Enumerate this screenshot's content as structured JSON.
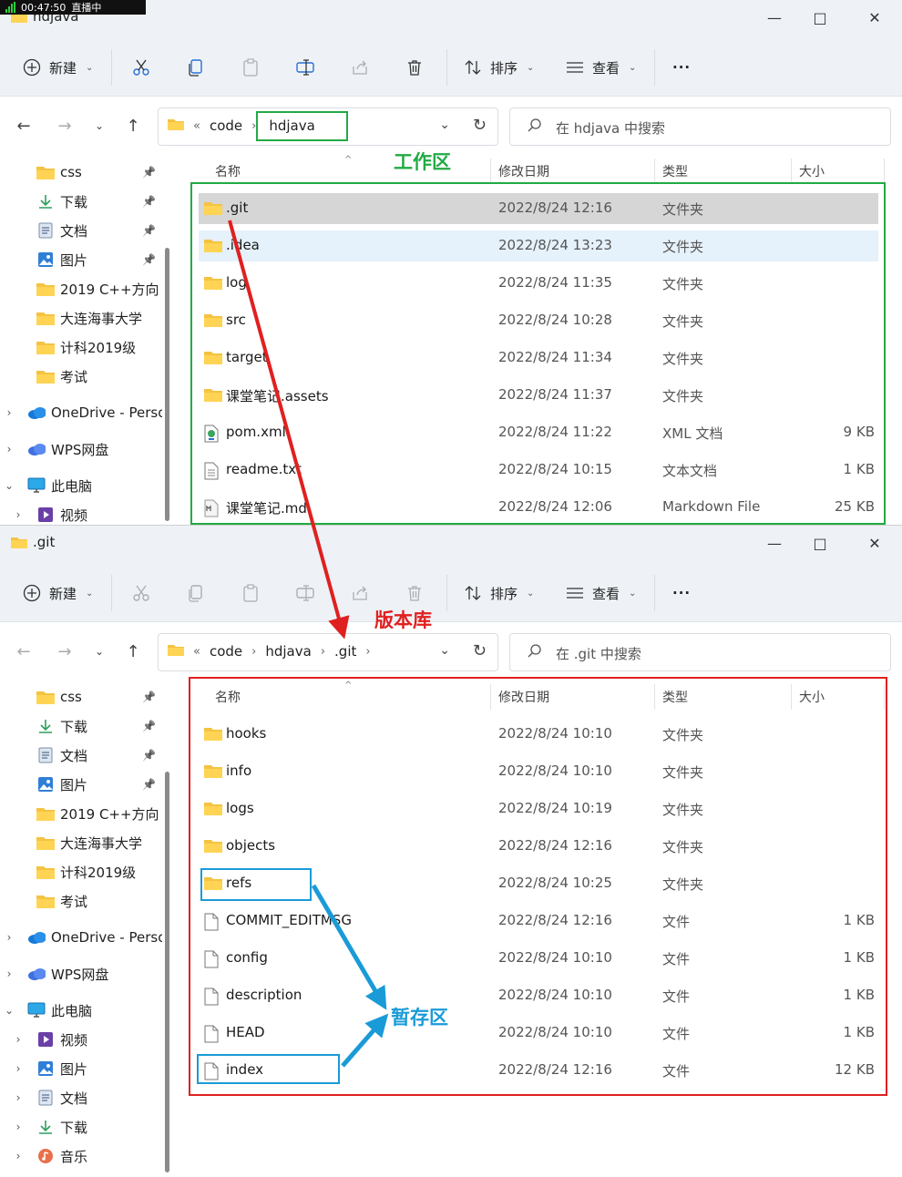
{
  "status_overlay": {
    "time": "00:47:50",
    "status": "直播中"
  },
  "window1": {
    "title": "hdjava",
    "toolbar": {
      "new": "新建",
      "sort": "排序",
      "view": "查看",
      "more": "···"
    },
    "breadcrumb": [
      "code",
      "hdjava"
    ],
    "breadcrumb_overflow": "«",
    "search_placeholder": "在 hdjava 中搜索",
    "columns": {
      "name": "名称",
      "date": "修改日期",
      "type": "类型",
      "size": "大小"
    },
    "files": [
      {
        "name": ".git",
        "date": "2022/8/24 12:16",
        "type": "文件夹",
        "size": "",
        "icon": "folder",
        "state": "selected"
      },
      {
        "name": ".idea",
        "date": "2022/8/24 13:23",
        "type": "文件夹",
        "size": "",
        "icon": "folder",
        "state": "hover"
      },
      {
        "name": "log",
        "date": "2022/8/24 11:35",
        "type": "文件夹",
        "size": "",
        "icon": "folder"
      },
      {
        "name": "src",
        "date": "2022/8/24 10:28",
        "type": "文件夹",
        "size": "",
        "icon": "folder"
      },
      {
        "name": "target",
        "date": "2022/8/24 11:34",
        "type": "文件夹",
        "size": "",
        "icon": "folder"
      },
      {
        "name": "课堂笔记.assets",
        "date": "2022/8/24 11:37",
        "type": "文件夹",
        "size": "",
        "icon": "folder"
      },
      {
        "name": "pom.xml",
        "date": "2022/8/24 11:22",
        "type": "XML 文档",
        "size": "9 KB",
        "icon": "xml"
      },
      {
        "name": "readme.txt",
        "date": "2022/8/24 10:15",
        "type": "文本文档",
        "size": "1 KB",
        "icon": "txt"
      },
      {
        "name": "课堂笔记.md",
        "date": "2022/8/24 12:06",
        "type": "Markdown File",
        "size": "25 KB",
        "icon": "md"
      }
    ],
    "sidebar": [
      {
        "label": "css",
        "icon": "folder",
        "pinned": true
      },
      {
        "label": "下载",
        "icon": "download",
        "pinned": true
      },
      {
        "label": "文档",
        "icon": "document",
        "pinned": true
      },
      {
        "label": "图片",
        "icon": "picture",
        "pinned": true
      },
      {
        "label": "2019 C++方向",
        "icon": "folder",
        "pinned": false
      },
      {
        "label": "大连海事大学",
        "icon": "folder",
        "pinned": false
      },
      {
        "label": "计科2019级",
        "icon": "folder",
        "pinned": false
      },
      {
        "label": "考试",
        "icon": "folder",
        "pinned": false
      },
      {
        "label": "OneDrive - Perso",
        "icon": "onedrive",
        "chevron": "›"
      },
      {
        "label": "WPS网盘",
        "icon": "wps",
        "chevron": "›"
      },
      {
        "label": "此电脑",
        "icon": "pc",
        "chevron": "⌄"
      },
      {
        "label": "视频",
        "icon": "video",
        "chevron": "›"
      }
    ]
  },
  "window2": {
    "title": ".git",
    "toolbar": {
      "new": "新建",
      "sort": "排序",
      "view": "查看",
      "more": "···"
    },
    "breadcrumb": [
      "code",
      "hdjava",
      ".git"
    ],
    "breadcrumb_overflow": "«",
    "search_placeholder": "在 .git 中搜索",
    "columns": {
      "name": "名称",
      "date": "修改日期",
      "type": "类型",
      "size": "大小"
    },
    "files": [
      {
        "name": "hooks",
        "date": "2022/8/24 10:10",
        "type": "文件夹",
        "size": "",
        "icon": "folder"
      },
      {
        "name": "info",
        "date": "2022/8/24 10:10",
        "type": "文件夹",
        "size": "",
        "icon": "folder"
      },
      {
        "name": "logs",
        "date": "2022/8/24 10:19",
        "type": "文件夹",
        "size": "",
        "icon": "folder"
      },
      {
        "name": "objects",
        "date": "2022/8/24 12:16",
        "type": "文件夹",
        "size": "",
        "icon": "folder"
      },
      {
        "name": "refs",
        "date": "2022/8/24 10:25",
        "type": "文件夹",
        "size": "",
        "icon": "folder"
      },
      {
        "name": "COMMIT_EDITMSG",
        "date": "2022/8/24 12:16",
        "type": "文件",
        "size": "1 KB",
        "icon": "file"
      },
      {
        "name": "config",
        "date": "2022/8/24 10:10",
        "type": "文件",
        "size": "1 KB",
        "icon": "file"
      },
      {
        "name": "description",
        "date": "2022/8/24 10:10",
        "type": "文件",
        "size": "1 KB",
        "icon": "file"
      },
      {
        "name": "HEAD",
        "date": "2022/8/24 10:10",
        "type": "文件",
        "size": "1 KB",
        "icon": "file"
      },
      {
        "name": "index",
        "date": "2022/8/24 12:16",
        "type": "文件",
        "size": "12 KB",
        "icon": "file"
      }
    ],
    "sidebar": [
      {
        "label": "css",
        "icon": "folder",
        "pinned": true
      },
      {
        "label": "下载",
        "icon": "download",
        "pinned": true
      },
      {
        "label": "文档",
        "icon": "document",
        "pinned": true
      },
      {
        "label": "图片",
        "icon": "picture",
        "pinned": true
      },
      {
        "label": "2019 C++方向",
        "icon": "folder",
        "pinned": false
      },
      {
        "label": "大连海事大学",
        "icon": "folder",
        "pinned": false
      },
      {
        "label": "计科2019级",
        "icon": "folder",
        "pinned": false
      },
      {
        "label": "考试",
        "icon": "folder",
        "pinned": false
      },
      {
        "label": "OneDrive - Perso",
        "icon": "onedrive",
        "chevron": "›"
      },
      {
        "label": "WPS网盘",
        "icon": "wps",
        "chevron": "›"
      },
      {
        "label": "此电脑",
        "icon": "pc",
        "chevron": "⌄"
      },
      {
        "label": "视频",
        "icon": "video",
        "chevron": "›"
      },
      {
        "label": "图片",
        "icon": "picture",
        "chevron": "›"
      },
      {
        "label": "文档",
        "icon": "document",
        "chevron": "›"
      },
      {
        "label": "下载",
        "icon": "download",
        "chevron": "›"
      },
      {
        "label": "音乐",
        "icon": "music",
        "chevron": "›"
      }
    ]
  },
  "annotations": {
    "workspace_label": "工作区",
    "repository_label": "版本库",
    "staging_label": "暂存区",
    "colors": {
      "workspace": "#22aa44",
      "repository": "#e02020",
      "staging": "#1a9bd7"
    }
  }
}
